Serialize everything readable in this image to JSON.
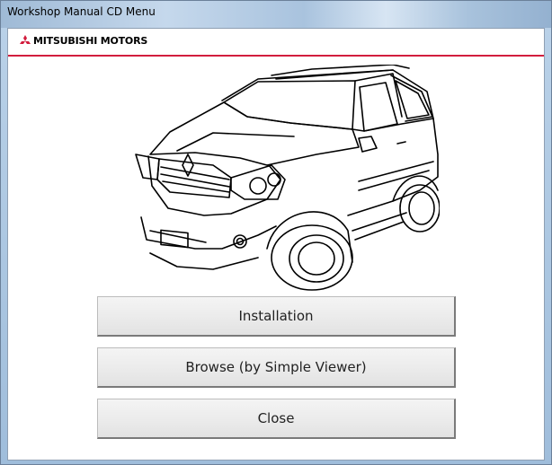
{
  "window": {
    "title": "Workshop Manual CD Menu"
  },
  "brand": {
    "name": "MITSUBISHI MOTORS",
    "logo_icon": "mitsubishi-three-diamond-icon",
    "accent_color": "#d21d3e"
  },
  "illustration": {
    "icon": "suv-line-drawing"
  },
  "buttons": {
    "installation": "Installation",
    "browse": "Browse (by Simple Viewer)",
    "close": "Close"
  }
}
